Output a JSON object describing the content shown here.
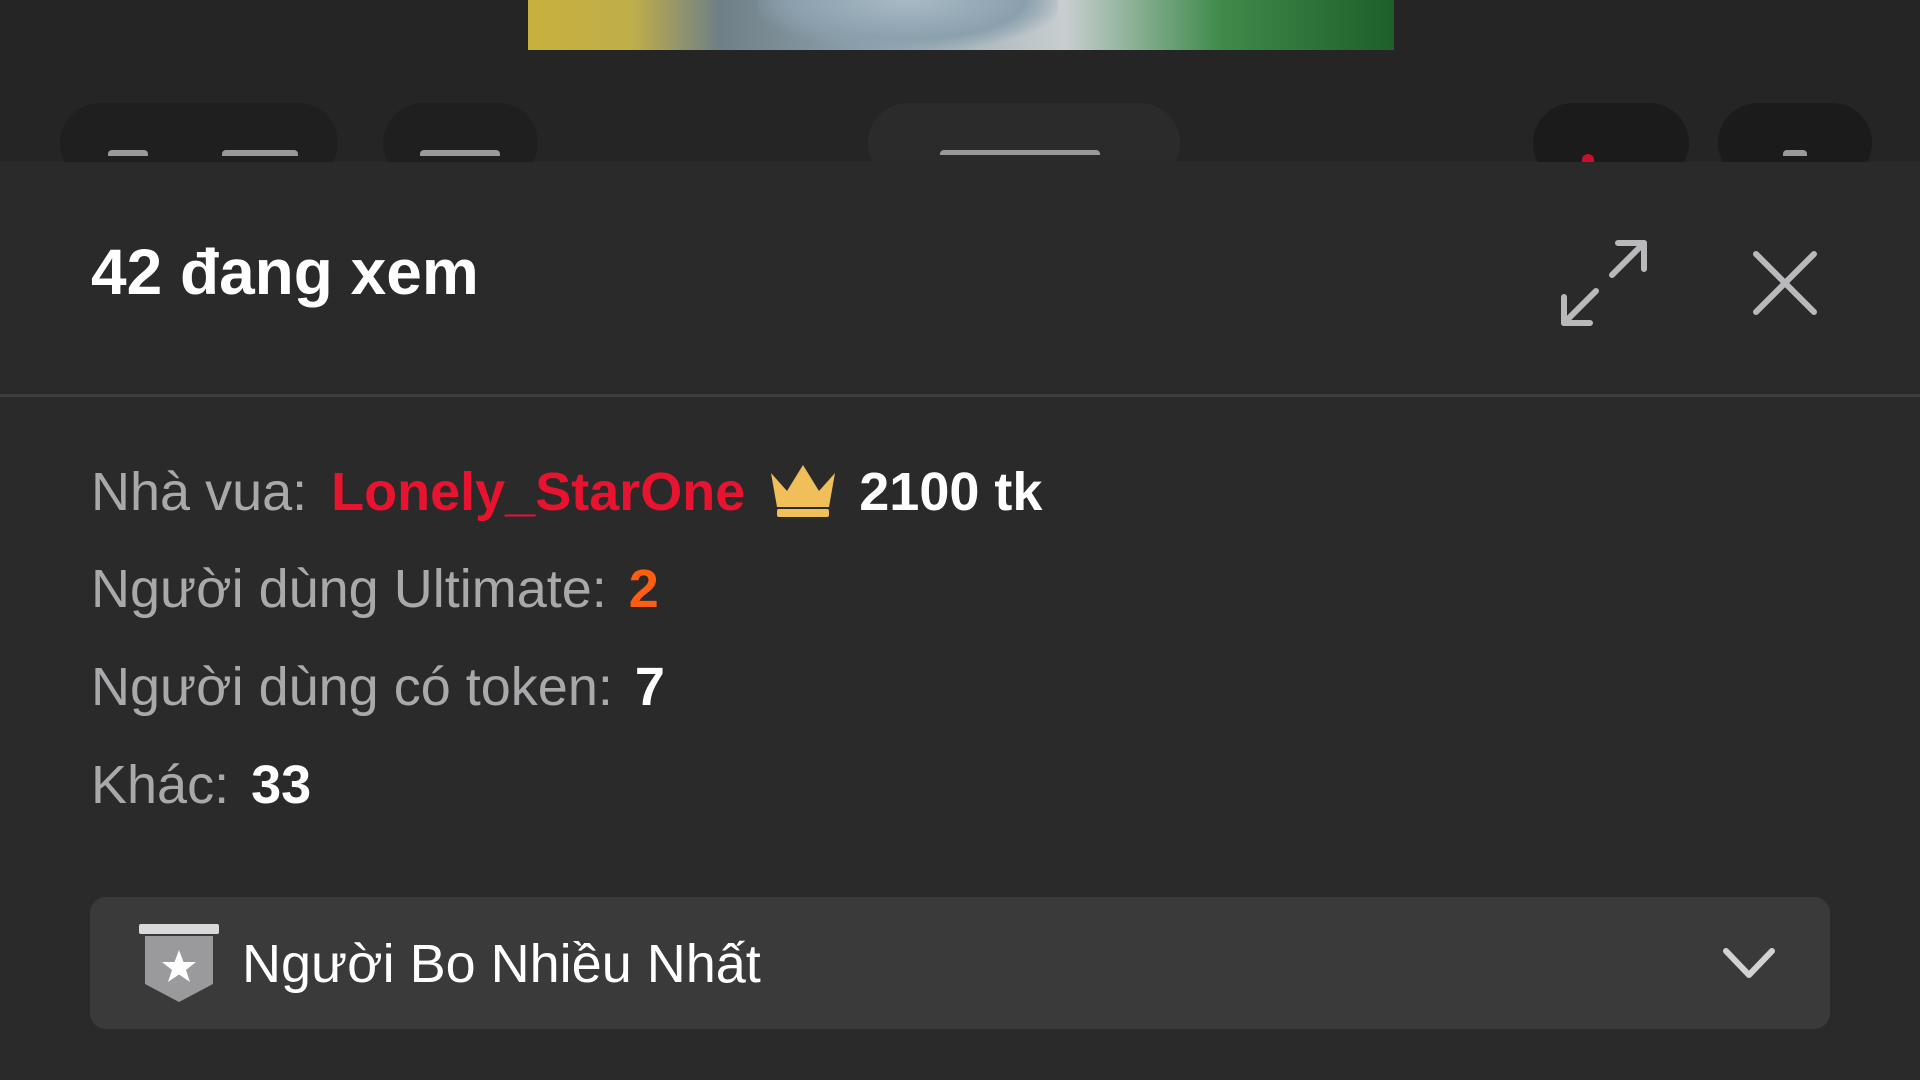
{
  "header": {
    "viewer_count": "42 đang xem",
    "expand_icon": "expand-arrows-icon",
    "close_icon": "close-x-icon"
  },
  "stats": {
    "king_label": "Nhà vua:",
    "king_name": "Lonely_StarOne",
    "king_icon": "crown-icon",
    "king_amount": "2100 tk",
    "ultimate_label": "Người dùng Ultimate:",
    "ultimate_value": "2",
    "token_label": "Người dùng có token:",
    "token_value": "7",
    "other_label": "Khác:",
    "other_value": "33"
  },
  "dropdown": {
    "label": "Người Bo Nhiều Nhất",
    "icon": "star-badge-icon",
    "chevron": "chevron-down-icon"
  },
  "colors": {
    "background": "#2a2a2b",
    "king_name": "#e8132f",
    "ultimate_value": "#ff5d12",
    "crown": "#f0bf5a",
    "label": "#a9a9ab",
    "dropdown_bg": "#3a3a3b"
  }
}
